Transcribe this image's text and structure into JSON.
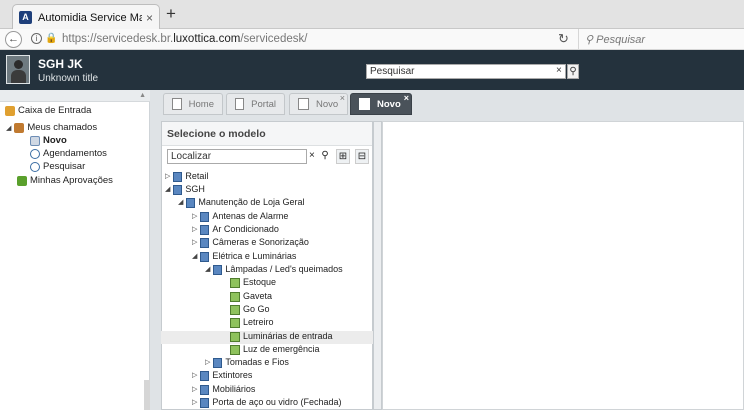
{
  "browser": {
    "tab_title": "Automidia Service Manager",
    "tab_close": "×",
    "new_tab": "+",
    "url_prefix": "https://servicedesk.br.",
    "url_domain": "luxottica.com",
    "url_path": "/servicedesk/",
    "search_placeholder": "Pesquisar",
    "icons": [
      "back-icon",
      "info-icon",
      "lock-icon",
      "reload-icon",
      "search-icon"
    ]
  },
  "header": {
    "user_name": "SGH JK",
    "user_title": "Unknown title",
    "search_value": "Pesquisar",
    "clear": "×",
    "search_btn": "⚲",
    "bg": "#24323d"
  },
  "sidebar": {
    "inbox": "Caixa de Entrada",
    "my_calls": "Meus chamados",
    "new": "Novo",
    "schedules": "Agendamentos",
    "search": "Pesquisar",
    "approvals": "Minhas Aprovações"
  },
  "tabs": [
    {
      "label": "Home"
    },
    {
      "label": "Portal"
    },
    {
      "label": "Novo"
    },
    {
      "label": "Novo"
    }
  ],
  "panel": {
    "title": "Selecione o modelo",
    "find_value": "Localizar",
    "find_clear": "×",
    "find_search": "⚲",
    "tree": [
      {
        "label": "Retail"
      },
      {
        "label": "SGH"
      },
      {
        "label": "Manutenção de Loja Geral"
      },
      {
        "label": "Antenas de Alarme"
      },
      {
        "label": "Ar Condicionado"
      },
      {
        "label": "Câmeras e Sonorização"
      },
      {
        "label": "Elétrica e Luminárias"
      },
      {
        "label": "Lâmpadas / Led's queimados"
      },
      {
        "label": "Estoque"
      },
      {
        "label": "Gaveta"
      },
      {
        "label": "Go Go"
      },
      {
        "label": "Letreiro"
      },
      {
        "label": "Luminárias de entrada"
      },
      {
        "label": "Luz de emergência"
      },
      {
        "label": "Tomadas e Fios"
      },
      {
        "label": "Extintores"
      },
      {
        "label": "Mobiliários"
      },
      {
        "label": "Porta de aço ou vidro (Fechada)"
      }
    ]
  }
}
